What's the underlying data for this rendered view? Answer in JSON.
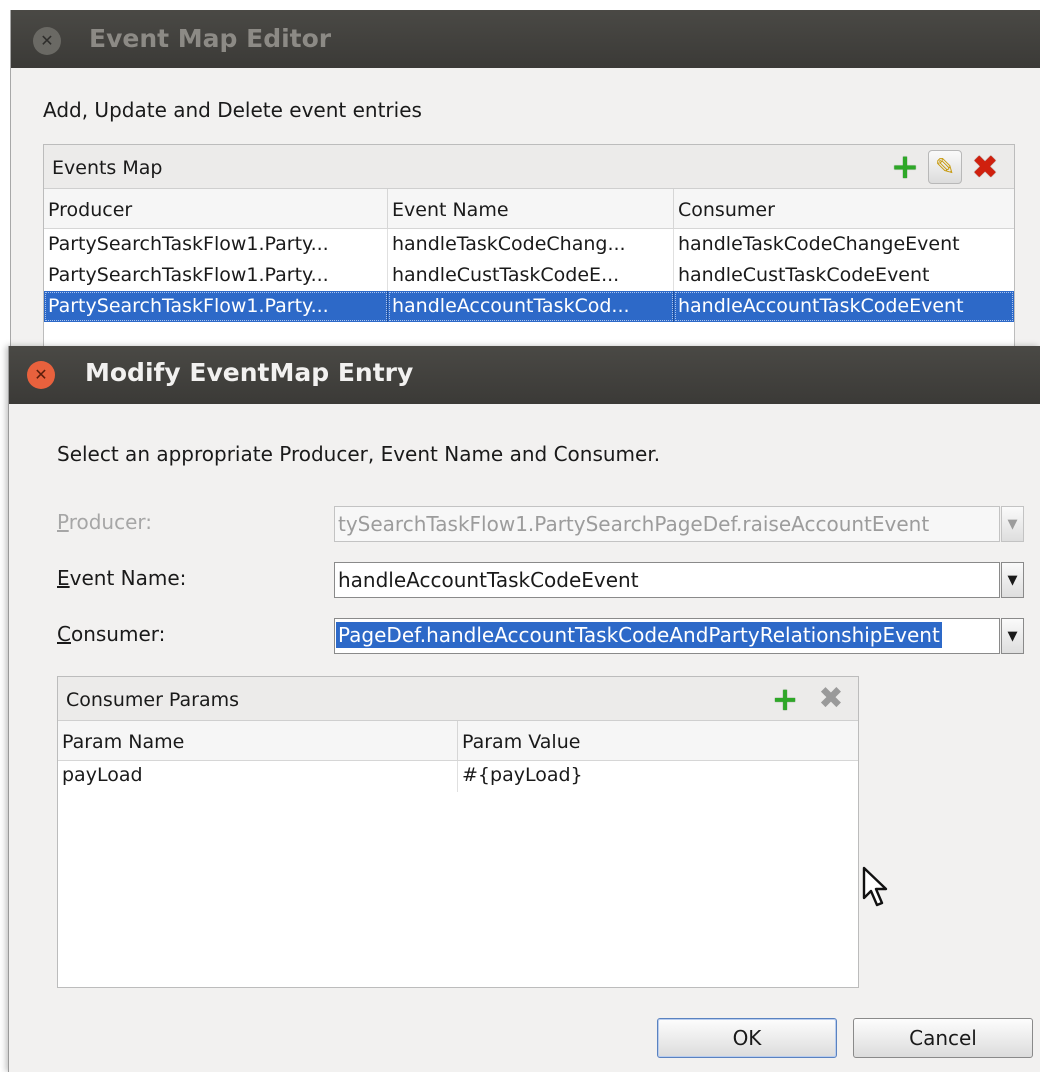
{
  "editor": {
    "title": "Event Map Editor",
    "close_glyph": "✕",
    "subtitle": "Add, Update and Delete event entries",
    "panel_title": "Events Map",
    "toolbar": {
      "add_icon": "+",
      "edit_icon": "✎",
      "delete_icon": "✖"
    },
    "columns": [
      "Producer",
      "Event Name",
      "Consumer"
    ],
    "rows": [
      {
        "producer": "PartySearchTaskFlow1.Party...",
        "event_name": "handleTaskCodeChang...",
        "consumer": "handleTaskCodeChangeEvent"
      },
      {
        "producer": "PartySearchTaskFlow1.Party...",
        "event_name": "handleCustTaskCodeE...",
        "consumer": "handleCustTaskCodeEvent"
      },
      {
        "producer": "PartySearchTaskFlow1.Party...",
        "event_name": "handleAccountTaskCod...",
        "consumer": "handleAccountTaskCodeEvent"
      }
    ],
    "selected_row_index": 2
  },
  "modify": {
    "title": "Modify EventMap Entry",
    "close_glyph": "✕",
    "subtitle": "Select an appropriate Producer, Event Name and Consumer.",
    "producer": {
      "mnemonic": "P",
      "label_rest": "roducer:",
      "value": "tySearchTaskFlow1.PartySearchPageDef.raiseAccountEvent",
      "disabled": true
    },
    "event_name": {
      "mnemonic": "E",
      "label_rest": "vent Name:",
      "value": "handleAccountTaskCodeEvent"
    },
    "consumer": {
      "mnemonic": "C",
      "label_rest": "onsumer:",
      "value": "PageDef.handleAccountTaskCodeAndPartyRelationshipEvent"
    },
    "dropdown_glyph": "▼",
    "params": {
      "title": "Consumer Params",
      "add_icon": "+",
      "delete_icon": "✖",
      "columns": [
        "Param Name",
        "Param Value"
      ],
      "rows": [
        {
          "name": "payLoad",
          "value": "#{payLoad}"
        }
      ]
    },
    "ok_label": "OK",
    "cancel_label": "Cancel"
  },
  "colors": {
    "titlebar": "#3b3a37",
    "dialog_bg": "#f2f1f0",
    "selection": "#2d69c8",
    "close_active": "#e8613d",
    "add_green": "#2ea828",
    "delete_red": "#d0200e"
  }
}
